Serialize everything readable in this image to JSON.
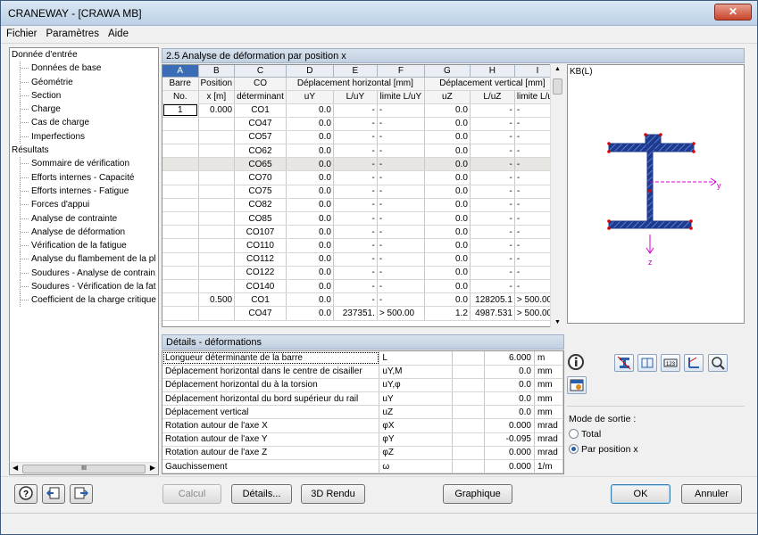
{
  "window": {
    "title": "CRANEWAY - [CRAWA MB]",
    "close_glyph": "✕"
  },
  "menu": [
    "Fichier",
    "Paramètres",
    "Aide"
  ],
  "nav": {
    "items": [
      {
        "label": "Donnée d'entrée",
        "level": 0
      },
      {
        "label": "Données de base",
        "level": 1
      },
      {
        "label": "Géométrie",
        "level": 1
      },
      {
        "label": "Section",
        "level": 1
      },
      {
        "label": "Charge",
        "level": 1
      },
      {
        "label": "Cas de charge",
        "level": 1
      },
      {
        "label": "Imperfections",
        "level": 1
      },
      {
        "label": "Résultats",
        "level": 0
      },
      {
        "label": "Sommaire de vérification",
        "level": 1
      },
      {
        "label": "Efforts internes - Capacité",
        "level": 1
      },
      {
        "label": "Efforts internes - Fatigue",
        "level": 1
      },
      {
        "label": "Forces d'appui",
        "level": 1
      },
      {
        "label": "Analyse de contrainte",
        "level": 1
      },
      {
        "label": "Analyse de déformation",
        "level": 1
      },
      {
        "label": "Vérification de la fatigue",
        "level": 1
      },
      {
        "label": "Analyse du flambement de la pl",
        "level": 1
      },
      {
        "label": "Soudures - Analyse de contrain",
        "level": 1
      },
      {
        "label": "Soudures - Vérification de la fat",
        "level": 1
      },
      {
        "label": "Coefficient de la charge critique",
        "level": 1
      }
    ],
    "scroll_grip": "III"
  },
  "panel": {
    "title": "2.5 Analyse de déformation par position x"
  },
  "table": {
    "col_letters": [
      "A",
      "B",
      "C",
      "D",
      "E",
      "F",
      "G",
      "H",
      "I"
    ],
    "group_headers": {
      "a": "Barre",
      "b": "Position",
      "c": "CO",
      "horiz": "Déplacement horizontal [mm]",
      "vert": "Déplacement vertical [mm]"
    },
    "sub_headers": [
      "No.",
      "x [m]",
      "déterminant",
      "uY",
      "L/uY",
      "limite L/uY",
      "uZ",
      "L/uZ",
      "limite L/uZ"
    ],
    "rows": [
      [
        "1",
        "0.000",
        "CO1",
        "0.0",
        "-",
        "-",
        "0.0",
        "-",
        "-"
      ],
      [
        "",
        "",
        "CO47",
        "0.0",
        "-",
        "-",
        "0.0",
        "-",
        "-"
      ],
      [
        "",
        "",
        "CO57",
        "0.0",
        "-",
        "-",
        "0.0",
        "-",
        "-"
      ],
      [
        "",
        "",
        "CO62",
        "0.0",
        "-",
        "-",
        "0.0",
        "-",
        "-"
      ],
      [
        "",
        "",
        "CO65",
        "0.0",
        "-",
        "-",
        "0.0",
        "-",
        "-"
      ],
      [
        "",
        "",
        "CO70",
        "0.0",
        "-",
        "-",
        "0.0",
        "-",
        "-"
      ],
      [
        "",
        "",
        "CO75",
        "0.0",
        "-",
        "-",
        "0.0",
        "-",
        "-"
      ],
      [
        "",
        "",
        "CO82",
        "0.0",
        "-",
        "-",
        "0.0",
        "-",
        "-"
      ],
      [
        "",
        "",
        "CO85",
        "0.0",
        "-",
        "-",
        "0.0",
        "-",
        "-"
      ],
      [
        "",
        "",
        "CO107",
        "0.0",
        "-",
        "-",
        "0.0",
        "-",
        "-"
      ],
      [
        "",
        "",
        "CO110",
        "0.0",
        "-",
        "-",
        "0.0",
        "-",
        "-"
      ],
      [
        "",
        "",
        "CO112",
        "0.0",
        "-",
        "-",
        "0.0",
        "-",
        "-"
      ],
      [
        "",
        "",
        "CO122",
        "0.0",
        "-",
        "-",
        "0.0",
        "-",
        "-"
      ],
      [
        "",
        "",
        "CO140",
        "0.0",
        "-",
        "-",
        "0.0",
        "-",
        "-"
      ],
      [
        "",
        "0.500",
        "CO1",
        "0.0",
        "-",
        "-",
        "0.0",
        "128205.1",
        "> 500.00"
      ],
      [
        "",
        "",
        "CO47",
        "0.0",
        "237351.",
        "> 500.00",
        "1.2",
        "4987.531",
        "> 500.00"
      ]
    ]
  },
  "details": {
    "title": "Détails - déformations",
    "rows": [
      {
        "label": "Longueur déterminante de la barre",
        "symbol": "L",
        "value": "6.000",
        "unit": "m"
      },
      {
        "label": "Déplacement horizontal dans le centre de cisailler",
        "symbol": "uY,M",
        "value": "0.0",
        "unit": "mm"
      },
      {
        "label": "Déplacement horizontal du à la torsion",
        "symbol": "uY,φ",
        "value": "0.0",
        "unit": "mm"
      },
      {
        "label": "Déplacement horizontal du bord supérieur du rail",
        "symbol": "uY",
        "value": "0.0",
        "unit": "mm"
      },
      {
        "label": "Déplacement vertical",
        "symbol": "uZ",
        "value": "0.0",
        "unit": "mm"
      },
      {
        "label": "Rotation autour de l'axe X",
        "symbol": "φX",
        "value": "0.000",
        "unit": "mrad"
      },
      {
        "label": "Rotation autour de l'axe Y",
        "symbol": "φY",
        "value": "-0.095",
        "unit": "mrad"
      },
      {
        "label": "Rotation autour de l'axe Z",
        "symbol": "φZ",
        "value": "0.000",
        "unit": "mrad"
      },
      {
        "label": "Gauchissement",
        "symbol": "ω",
        "value": "0.000",
        "unit": "1/m"
      }
    ]
  },
  "graphic": {
    "caption": "KB(L)",
    "axis_y": "y",
    "axis_z": "z"
  },
  "output_mode": {
    "label": "Mode de sortie :",
    "options": [
      "Total",
      "Par position x"
    ],
    "selected": "Par position x"
  },
  "buttons": {
    "calc": "Calcul",
    "details": "Détails...",
    "render3d": "3D Rendu",
    "graph": "Graphique",
    "ok": "OK",
    "cancel": "Annuler"
  },
  "colors": {
    "accent": "#3a6db5",
    "section_fill": "#1e3a8a",
    "hatch": "#2563eb"
  }
}
